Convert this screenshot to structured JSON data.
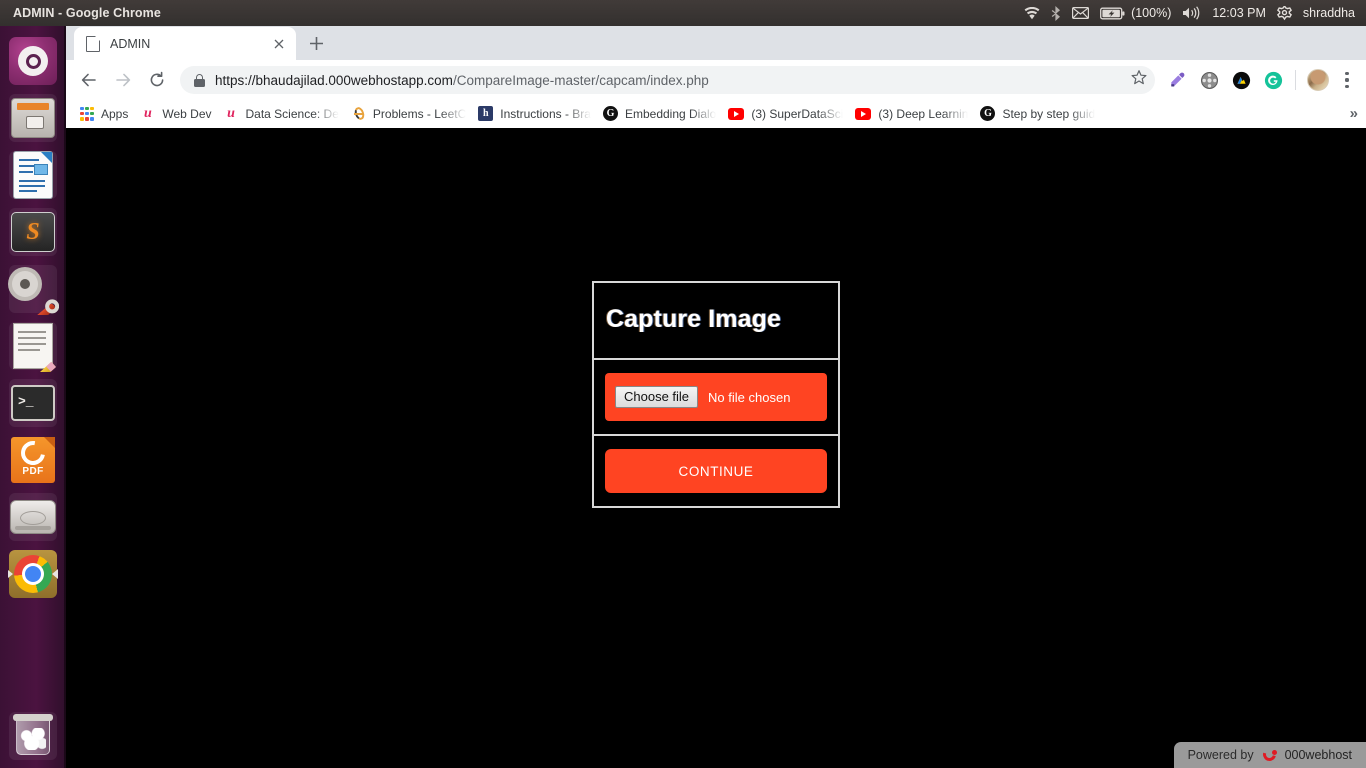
{
  "os_panel": {
    "window_title": "ADMIN - Google Chrome",
    "tray": {
      "wifi_icon": "wifi-icon",
      "bluetooth_icon": "bluetooth-icon",
      "mail_icon": "mail-icon",
      "battery_icon": "battery-charging-icon",
      "battery_level": "(100%)",
      "volume_icon": "volume-icon",
      "clock": "12:03 PM",
      "settings_icon": "gear-icon",
      "username": "shraddha"
    }
  },
  "launcher": {
    "items": [
      {
        "name": "ubuntu-dash",
        "icon": "ubuntu-logo-icon"
      },
      {
        "name": "files",
        "icon": "file-cabinet-icon"
      },
      {
        "name": "libreoffice-writer",
        "icon": "document-icon"
      },
      {
        "name": "sublime-text",
        "icon": "sublime-s-icon"
      },
      {
        "name": "system-settings",
        "icon": "gear-wrench-icon"
      },
      {
        "name": "text-editor",
        "icon": "notepad-pencil-icon"
      },
      {
        "name": "terminal",
        "icon": "terminal-icon"
      },
      {
        "name": "foxit-pdf-reader",
        "icon": "pdf-icon",
        "label": "PDF"
      },
      {
        "name": "disk-utility",
        "icon": "hard-disk-icon"
      },
      {
        "name": "google-chrome",
        "icon": "chrome-icon"
      },
      {
        "name": "trash",
        "icon": "trash-icon"
      }
    ]
  },
  "browser": {
    "tab": {
      "title": "ADMIN",
      "favicon": "page-icon",
      "close_icon": "close-icon"
    },
    "new_tab_icon": "plus-icon",
    "nav": {
      "back_icon": "back-arrow-icon",
      "forward_icon": "forward-arrow-icon",
      "reload_icon": "reload-icon"
    },
    "omnibox": {
      "lock_icon": "lock-icon",
      "scheme": "https://",
      "host": "bhaudajilad.000webhostapp.com",
      "path": "/CompareImage-master/capcam/index.php",
      "bookmark_star_icon": "star-icon"
    },
    "extensions": [
      {
        "name": "eyedropper-extension",
        "icon": "eyedropper-icon"
      },
      {
        "name": "film-reel-extension",
        "icon": "film-reel-icon"
      },
      {
        "name": "dark-extension",
        "icon": "dark-circle-icon"
      },
      {
        "name": "grammarly-extension",
        "icon": "grammarly-g-icon"
      }
    ],
    "profile_icon": "avatar-icon",
    "menu_icon": "three-dot-menu-icon",
    "bookmarks": [
      {
        "label": "Apps",
        "icon": "apps-grid-icon",
        "truncated": false
      },
      {
        "label": "Web Dev",
        "icon": "udemy-u-icon",
        "truncated": false
      },
      {
        "label": "Data Science: De",
        "icon": "udemy-u-icon",
        "truncated": true
      },
      {
        "label": "Problems - LeetC",
        "icon": "leetcode-icon",
        "truncated": true
      },
      {
        "label": "Instructions - Bra",
        "icon": "h-square-icon",
        "truncated": true
      },
      {
        "label": "Embedding Dialo",
        "icon": "google-g-icon",
        "truncated": true
      },
      {
        "label": "(3) SuperDataSci",
        "icon": "youtube-icon",
        "truncated": true
      },
      {
        "label": "(3) Deep Learnin",
        "icon": "youtube-icon",
        "truncated": true
      },
      {
        "label": "Step by step guid",
        "icon": "google-g-icon",
        "truncated": true
      }
    ],
    "bookmarks_overflow_icon": "chevron-right-overflow"
  },
  "page": {
    "background_color": "#000000",
    "card": {
      "title": "Capture Image",
      "file_input": {
        "button_label": "Choose file",
        "status_text": "No file chosen",
        "accent_color": "#ff4422"
      },
      "continue_button": {
        "label": "CONTINUE",
        "color": "#ff4422"
      },
      "border_color": "#d8d8d8"
    },
    "footer_badge": {
      "prefix": "Powered by",
      "brand": "000webhost",
      "logo_icon": "000webhost-logo-icon"
    }
  }
}
